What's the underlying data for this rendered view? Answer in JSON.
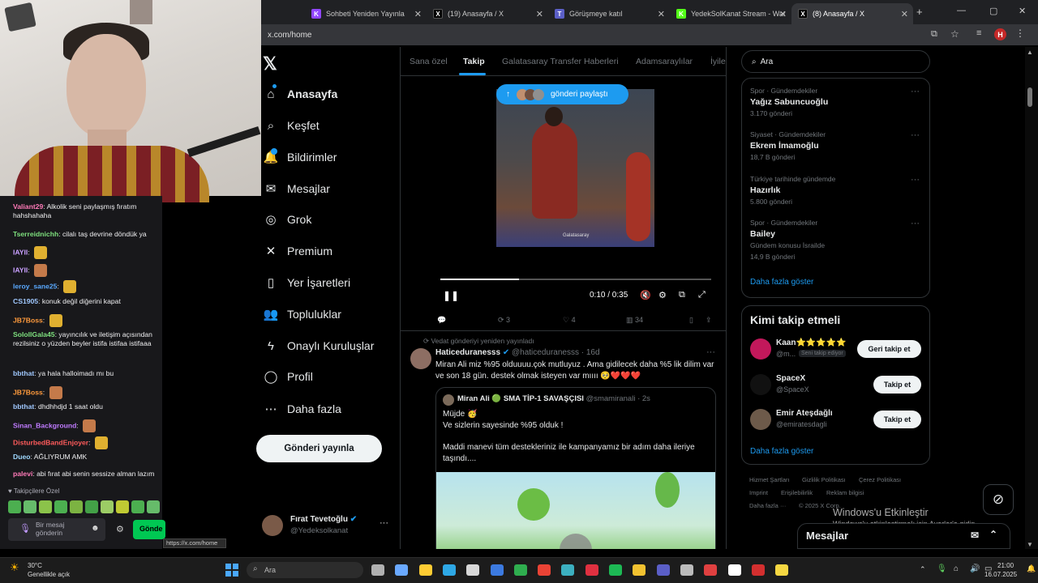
{
  "browser": {
    "tabs": [
      {
        "label": "Sohbeti Yeniden Yayınla",
        "color": "#9146ff",
        "icon": "K"
      },
      {
        "label": "(19) Anasayfa / X",
        "color": "#000000",
        "icon": "X"
      },
      {
        "label": "Görüşmeye katıl",
        "color": "#5b5fc7",
        "icon": "T"
      },
      {
        "label": "YedekSolKanat Stream - Wat",
        "color": "#53fc18",
        "icon": "K"
      },
      {
        "label": "(8) Anasayfa / X",
        "color": "#000000",
        "icon": "X"
      }
    ],
    "url": "x.com/home",
    "profile_letter": "H"
  },
  "chat": {
    "messages": [
      {
        "user": "Valiant29",
        "text": "Alkolik seni paylaşmış fıratım hahshahaha",
        "color": "#ff7ab8"
      },
      {
        "user": "Tserreidnichh",
        "text": "cilalı taş devrine döndük ya",
        "color": "#7ee07e"
      },
      {
        "user": "IAYII",
        "text": "",
        "color": "#c9a0ff"
      },
      {
        "user": "IAYII",
        "text": "",
        "color": "#c9a0ff"
      },
      {
        "user": "leroy_sane25",
        "text": "",
        "color": "#5aa9ff"
      },
      {
        "user": "CS1905",
        "text": "konuk değil diğerini kapat",
        "color": "#a0c8ff"
      },
      {
        "user": "JB7Boss",
        "text": "",
        "color": "#ff9a3c"
      },
      {
        "user": "SolollGala45",
        "text": "yayıncılık ve iletişim açısından rezilsiniz o yüzden beyler istifa istifaa istifaaa",
        "color": "#7ee07e"
      },
      {
        "user": "bbthat",
        "text": "ya hala halloimadı mı bu",
        "color": "#a0c8ff"
      },
      {
        "user": "JB7Boss",
        "text": "",
        "color": "#ff9a3c"
      },
      {
        "user": "bbthat",
        "text": "dhdhhdjd 1 saat oldu",
        "color": "#a0c8ff"
      },
      {
        "user": "Sinan_Background",
        "text": "",
        "color": "#c07bff"
      },
      {
        "user": "DisturbedBandEnjoyer",
        "text": "",
        "color": "#ff5b5b"
      },
      {
        "user": "Dueo",
        "text": "AĞLIYRUM AMK",
        "color": "#9fd8ff"
      },
      {
        "user": "palevi",
        "text": "abi fırat abi senin sessize alman lazım",
        "color": "#ff7ab8"
      }
    ],
    "followers_only": "Takipçilere Özel",
    "input_placeholder": "Bir mesaj gönderin",
    "send_label": "Gönde",
    "link_tooltip": "https://x.com/home"
  },
  "xnav": {
    "items": [
      {
        "label": "Anasayfa",
        "icon": "⌂"
      },
      {
        "label": "Keşfet",
        "icon": "⌕"
      },
      {
        "label": "Bildirimler",
        "icon": "🔔"
      },
      {
        "label": "Mesajlar",
        "icon": "✉"
      },
      {
        "label": "Grok",
        "icon": "◎"
      },
      {
        "label": "Premium",
        "icon": "✕"
      },
      {
        "label": "Yer İşaretleri",
        "icon": "▯"
      },
      {
        "label": "Topluluklar",
        "icon": "👥"
      },
      {
        "label": "Onaylı Kuruluşlar",
        "icon": "ϟ"
      },
      {
        "label": "Profil",
        "icon": "◯"
      },
      {
        "label": "Daha fazla",
        "icon": "⋯"
      }
    ],
    "post_button": "Gönderi yayınla",
    "profile": {
      "name": "Fırat Tevetoğlu",
      "handle": "@Yedeksolkanat"
    }
  },
  "center": {
    "tabs": [
      "Sana özel",
      "Takip",
      "Galatasaray Transfer Haberleri",
      "Adamsaraylılar",
      "İyile"
    ],
    "video": {
      "pill": "gönderi paylaştı",
      "time": "0:10 / 0:35",
      "progress": 0.29,
      "watermark": "Galatasaray"
    },
    "actions1": {
      "replies": "",
      "reposts": "3",
      "likes": "4",
      "views": "34"
    },
    "repost_note": "Vedat gönderiyi yeniden yayınladı",
    "tweet2": {
      "name": "Haticeduranesss",
      "handle": "@haticeduranesss · 16d",
      "text": "Miran Ali miz %95 olduuuu.çok mutluyuz . Ama gidilecek daha %5 lik dilim var ve son 18 gün. destek olmak isteyen var mıııı 🥺❤️❤️❤️"
    },
    "quote": {
      "name": "Miran Ali 🟢 SMA TİP-1 SAVAŞÇISI",
      "handle": "@smamiranali · 2s",
      "line1": "Müjde 🥳",
      "line2": "Ve sizlerin sayesinde %95 olduk !",
      "line3": "Maddi manevi tüm destekleriniz ile kampanyamız bir adım daha ileriye taşındı...."
    }
  },
  "right": {
    "search_placeholder": "Ara",
    "trends": [
      {
        "category": "Spor · Gündemdekiler",
        "name": "Yağız Sabuncuoğlu",
        "count": "3.170 gönderi",
        "extra": ""
      },
      {
        "category": "Siyaset · Gündemdekiler",
        "name": "Ekrem İmamoğlu",
        "count": "18,7 B gönderi",
        "extra": ""
      },
      {
        "category": "Türkiye tarihinde gündemde",
        "name": "Hazırlık",
        "count": "5.800 gönderi",
        "extra": ""
      },
      {
        "category": "Spor · Gündemdekiler",
        "name": "Bailey",
        "count": "14,9 B gönderi",
        "extra": "Gündem konusu İsrailde"
      }
    ],
    "show_more": "Daha fazla göster",
    "who_to_follow_title": "Kimi takip etmeli",
    "suggestions": [
      {
        "name": "Kaan⭐⭐⭐⭐⭐",
        "handle": "@m...",
        "badge": "Seni takip ediyor",
        "button": "Geri takip et",
        "color": "#c2185b"
      },
      {
        "name": "SpaceX",
        "handle": "@SpaceX",
        "badge": "",
        "button": "Takip et",
        "color": "#111111"
      },
      {
        "name": "Emir Ateşdağlı",
        "handle": "@emiratesdagli",
        "badge": "",
        "button": "Takip et",
        "color": "#6d5a4a"
      }
    ],
    "footer": [
      "Hizmet Şartları",
      "Gizlilik Politikası",
      "Çerez Politikası",
      "Imprint",
      "Erişilebilirlik",
      "Reklam bilgisi",
      "Daha fazla ···",
      "© 2025 X Corp."
    ],
    "messages_bar": "Mesajlar"
  },
  "windows": {
    "activate_title": "Windows'u Etkinleştir",
    "activate_sub": "Windows'u etkinleştirmek için Ayarlar'a gidin.",
    "weather_temp": "30°C",
    "weather_desc": "Genellikle açık",
    "search_label": "Ara",
    "time": "21:00",
    "date": "16.07.2025"
  }
}
